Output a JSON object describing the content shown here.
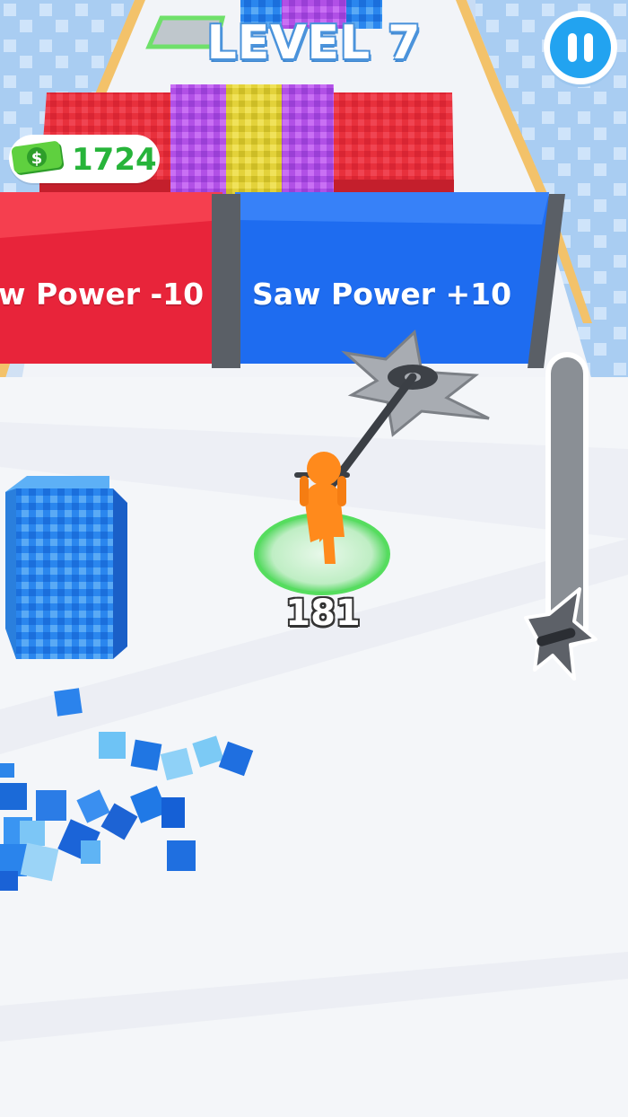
{
  "hud": {
    "level_label": "LEVEL 7",
    "money": "1724",
    "pause_icon": "pause-icon",
    "money_icon": "cash-icon"
  },
  "gates": {
    "left_label": "w Power -10",
    "right_label": "Saw Power +10",
    "left_color": "#e8243a",
    "right_color": "#1e6cf0"
  },
  "player": {
    "saw_power": "181",
    "color": "#ff8a1c"
  },
  "power_meter": {
    "level": 0.0,
    "icon": "shuriken-icon"
  }
}
